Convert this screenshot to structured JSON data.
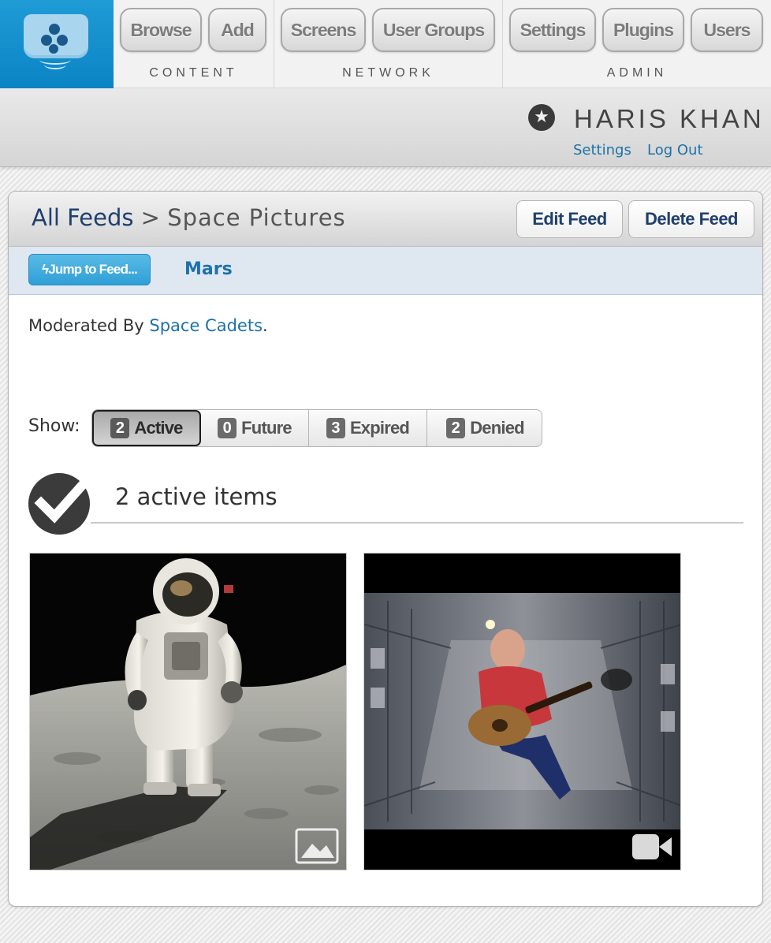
{
  "nav": {
    "groups": [
      {
        "label": "CONTENT",
        "buttons": [
          "Browse",
          "Add"
        ]
      },
      {
        "label": "NETWORK",
        "buttons": [
          "Screens",
          "User Groups"
        ]
      },
      {
        "label": "ADMIN",
        "buttons": [
          "Settings",
          "Plugins",
          "Users"
        ]
      }
    ]
  },
  "user": {
    "name": "HARIS KHAN",
    "settings_link": "Settings",
    "logout_link": "Log Out"
  },
  "breadcrumb": {
    "root": "All Feeds",
    "separator": " > ",
    "current": "Space Pictures"
  },
  "actions": {
    "edit": "Edit Feed",
    "delete": "Delete Feed"
  },
  "jump": {
    "button": "Jump to Feed...",
    "feed": "Mars"
  },
  "moderation": {
    "prefix": "Moderated By ",
    "group": "Space Cadets",
    "suffix": "."
  },
  "show": {
    "label": "Show:",
    "filters": [
      {
        "count": "2",
        "label": "Active"
      },
      {
        "count": "0",
        "label": "Future"
      },
      {
        "count": "3",
        "label": "Expired"
      },
      {
        "count": "2",
        "label": "Denied"
      }
    ],
    "selected": "Active"
  },
  "items": {
    "title": "2 active items",
    "tiles": [
      {
        "kind": "image-icon"
      },
      {
        "kind": "video-icon"
      }
    ]
  },
  "colors": {
    "brand": "#0b84c4",
    "link": "#1d72a8",
    "jump_button": "#2f9fd6"
  }
}
